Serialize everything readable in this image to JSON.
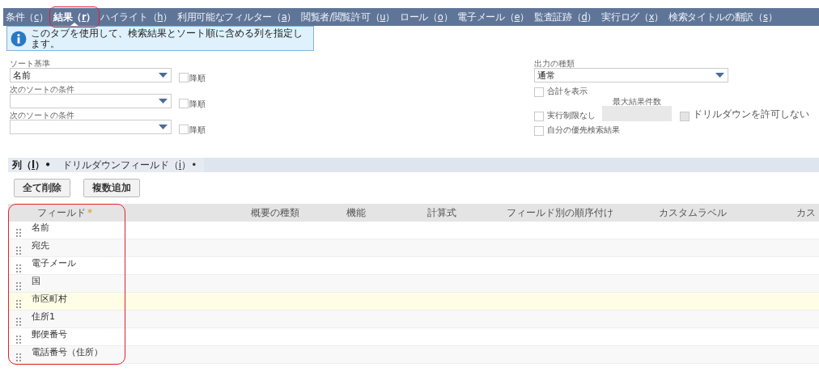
{
  "tabs": [
    {
      "text": "条件（",
      "key": "c",
      "end": "）",
      "selected": false,
      "annotated": false
    },
    {
      "text": "結果（",
      "key": "r",
      "end": "）",
      "selected": true,
      "annotated": true
    },
    {
      "text": "ハイライト（",
      "key": "h",
      "end": "）",
      "selected": false,
      "annotated": false
    },
    {
      "text": "利用可能なフィルター（",
      "key": "a",
      "end": "）",
      "selected": false,
      "annotated": false
    },
    {
      "text": "閲覧者/閲覧許可（",
      "key": "u",
      "end": "）",
      "selected": false,
      "annotated": false
    },
    {
      "text": "ロール（",
      "key": "o",
      "end": "）",
      "selected": false,
      "annotated": false
    },
    {
      "text": "電子メール（",
      "key": "e",
      "end": "）",
      "selected": false,
      "annotated": false
    },
    {
      "text": "監査証跡（",
      "key": "d",
      "end": "）",
      "selected": false,
      "annotated": false
    },
    {
      "text": "実行ログ（",
      "key": "x",
      "end": "）",
      "selected": false,
      "annotated": false
    },
    {
      "text": "検索タイトルの翻訳（",
      "key": "s",
      "end": "）",
      "selected": false,
      "annotated": false
    }
  ],
  "info": "このタブを使用して、検索結果とソート順に含める列を指定します。",
  "sorts": [
    {
      "label": "ソート基準",
      "value": "名前",
      "check_label": "降順",
      "checked": false
    },
    {
      "label": "次のソートの条件",
      "check_label": "降順",
      "checked": false
    },
    {
      "label": "次のソートの条件",
      "check_label": "降順",
      "checked": false
    }
  ],
  "output": {
    "label": "出力の種類",
    "value": "通常",
    "show_totals": {
      "label": "合計を表示",
      "checked": false
    },
    "max_results_label": "最大結果件数",
    "unlimited": {
      "label": "実行制限なし",
      "checked": false
    },
    "no_drilldown": {
      "label": "ドリルダウンを許可しない",
      "checked": false,
      "disabled": true
    },
    "my_preferred": {
      "label": "自分の優先検索結果",
      "checked": false
    }
  },
  "subtabs": [
    {
      "text": "列（",
      "key": "l",
      "end": "）•",
      "selected": true
    },
    {
      "text": "ドリルダウンフィールド（",
      "key": "i",
      "end": "）•",
      "selected": false
    }
  ],
  "buttons": [
    "全て削除",
    "複数追加"
  ],
  "table": {
    "columns": [
      {
        "label": "フィールド",
        "required_mark": "*",
        "annotated": true
      },
      {
        "label": "概要の種類"
      },
      {
        "label": "機能"
      },
      {
        "label": "計算式"
      },
      {
        "label": "フィールド別の順序付け"
      },
      {
        "label": "カスタムラベル"
      },
      {
        "label": "カス"
      }
    ],
    "rows": [
      {
        "field": "名前",
        "selected": false
      },
      {
        "field": "宛先",
        "selected": false
      },
      {
        "field": "電子メール",
        "selected": false
      },
      {
        "field": "国",
        "selected": false
      },
      {
        "field": "市区町村",
        "selected": true
      },
      {
        "field": "住所1",
        "selected": false
      },
      {
        "field": "郵便番号",
        "selected": false
      },
      {
        "field": "電話番号（住所）",
        "selected": false
      }
    ]
  }
}
